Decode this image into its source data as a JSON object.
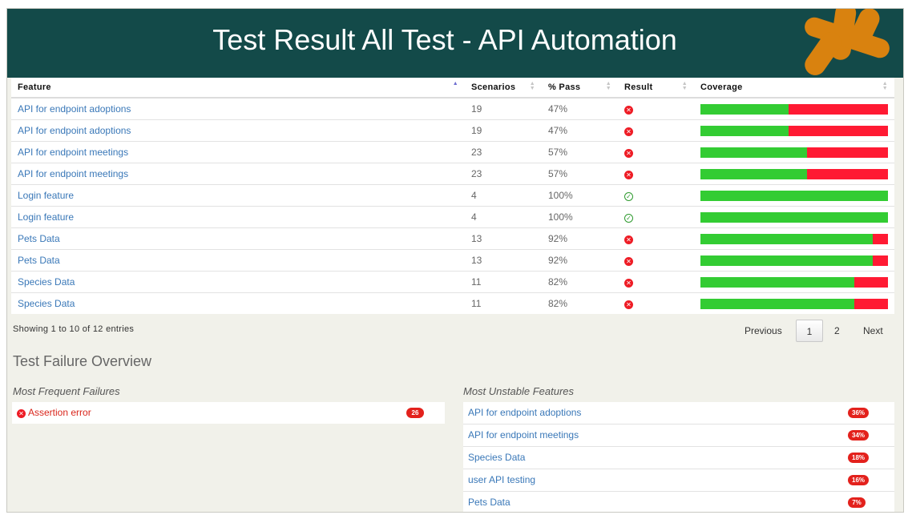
{
  "header": {
    "title": "Test Result All Test - API Automation"
  },
  "table": {
    "columns": [
      "Feature",
      "Scenarios",
      "% Pass",
      "Result",
      "Coverage"
    ],
    "rows": [
      {
        "feature": "API for endpoint adoptions",
        "scenarios": "19",
        "pass": "47%",
        "result": "fail",
        "coverage": 0.47
      },
      {
        "feature": "API for endpoint adoptions",
        "scenarios": "19",
        "pass": "47%",
        "result": "fail",
        "coverage": 0.47
      },
      {
        "feature": "API for endpoint meetings",
        "scenarios": "23",
        "pass": "57%",
        "result": "fail",
        "coverage": 0.57
      },
      {
        "feature": "API for endpoint meetings",
        "scenarios": "23",
        "pass": "57%",
        "result": "fail",
        "coverage": 0.57
      },
      {
        "feature": "Login feature",
        "scenarios": "4",
        "pass": "100%",
        "result": "pass",
        "coverage": 1.0
      },
      {
        "feature": "Login feature",
        "scenarios": "4",
        "pass": "100%",
        "result": "pass",
        "coverage": 1.0
      },
      {
        "feature": "Pets Data",
        "scenarios": "13",
        "pass": "92%",
        "result": "fail",
        "coverage": 0.92
      },
      {
        "feature": "Pets Data",
        "scenarios": "13",
        "pass": "92%",
        "result": "fail",
        "coverage": 0.92
      },
      {
        "feature": "Species Data",
        "scenarios": "11",
        "pass": "82%",
        "result": "fail",
        "coverage": 0.82
      },
      {
        "feature": "Species Data",
        "scenarios": "11",
        "pass": "82%",
        "result": "fail",
        "coverage": 0.82
      }
    ]
  },
  "pagination": {
    "info": "Showing 1 to 10 of 12 entries",
    "previous": "Previous",
    "page1": "1",
    "page2": "2",
    "next": "Next"
  },
  "failure_overview": {
    "title": "Test Failure Overview",
    "frequent_title": "Most Frequent Failures",
    "frequent": [
      {
        "label": "Assertion error",
        "count": "26"
      }
    ],
    "unstable_title": "Most Unstable Features",
    "unstable": [
      {
        "label": "API for endpoint adoptions",
        "value": "36%"
      },
      {
        "label": "API for endpoint meetings",
        "value": "34%"
      },
      {
        "label": "Species Data",
        "value": "18%"
      },
      {
        "label": "user API testing",
        "value": "16%"
      },
      {
        "label": "Pets Data",
        "value": "7%"
      }
    ]
  },
  "colors": {
    "header_bg": "#134a49",
    "logo": "#d9820f",
    "pass": "#33cc33",
    "fail": "#ff1a33",
    "link": "#3a78b8"
  }
}
